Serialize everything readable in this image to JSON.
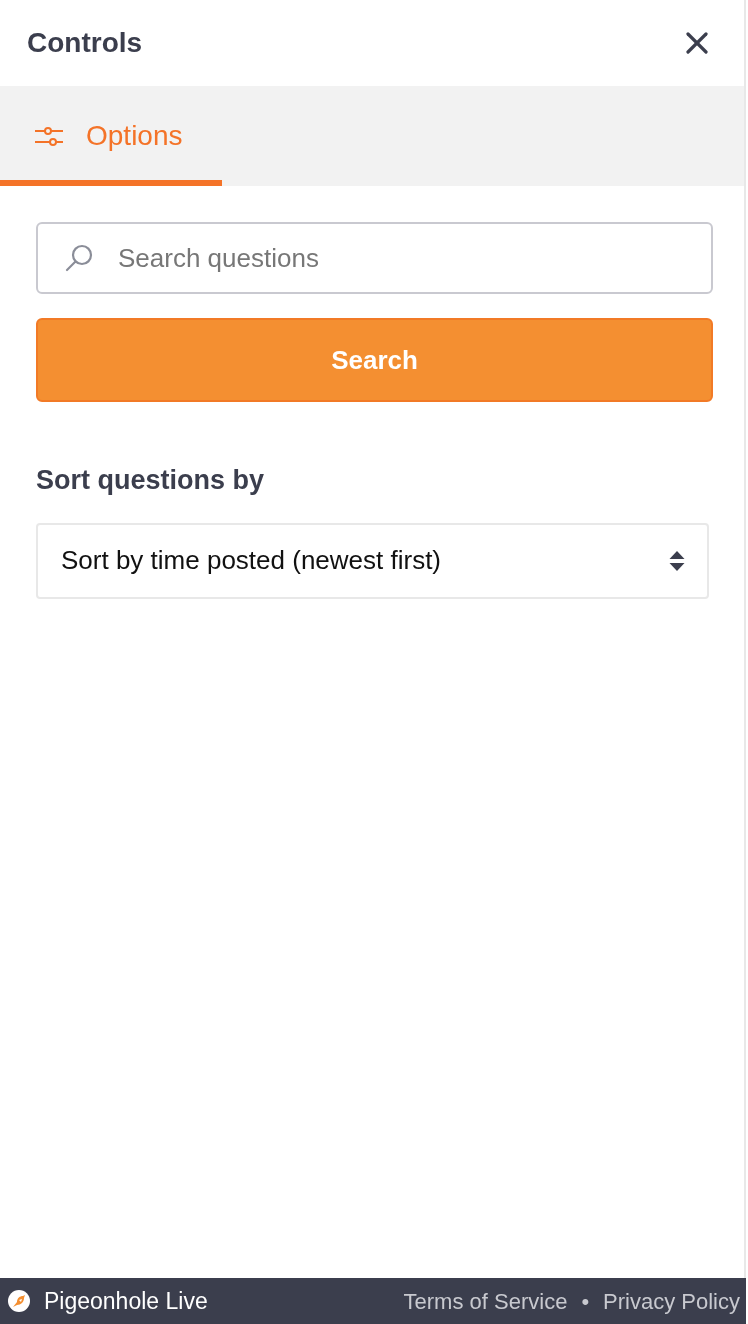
{
  "header": {
    "title": "Controls"
  },
  "tabs": [
    {
      "label": "Options",
      "selected": true
    }
  ],
  "search": {
    "placeholder": "Search questions",
    "button": "Search"
  },
  "sort": {
    "label": "Sort questions by",
    "value": "Sort by time posted (newest first)"
  },
  "footer": {
    "brand": "Pigeonhole Live",
    "links": [
      "Terms of Service",
      "Privacy Policy"
    ],
    "separator": "•"
  }
}
